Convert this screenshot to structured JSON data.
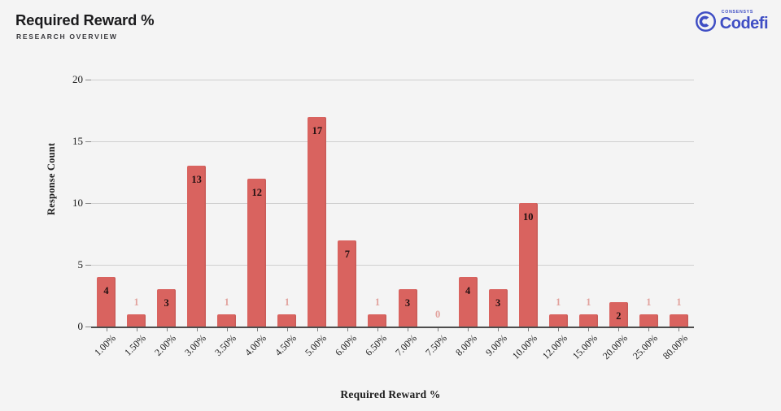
{
  "header": {
    "title": "Required Reward %",
    "subtitle": "RESEARCH OVERVIEW"
  },
  "logo": {
    "top_text": "CONSENSYS",
    "main_text": "Codefi",
    "color": "#3f4ec4"
  },
  "colors": {
    "background": "#f4f4f4",
    "bar": "#d9635f",
    "gridline": "#cfcfcf",
    "axis": "#4d4d4d",
    "label_inside": "#201011",
    "label_outside": "#e2a29d"
  },
  "chart_data": {
    "type": "bar",
    "title": "Required Reward %",
    "subtitle": "RESEARCH OVERVIEW",
    "xlabel": "Required Reward %",
    "ylabel": "Response Count",
    "ylim": [
      0,
      20
    ],
    "yticks": [
      0,
      5,
      10,
      15,
      20
    ],
    "grid": true,
    "legend": "none",
    "categories": [
      "1.00%",
      "1.50%",
      "2.00%",
      "3.00%",
      "3.50%",
      "4.00%",
      "4.50%",
      "5.00%",
      "6.00%",
      "6.50%",
      "7.00%",
      "7.50%",
      "8.00%",
      "9.00%",
      "10.00%",
      "12.00%",
      "15.00%",
      "20.00%",
      "25.00%",
      "80.00%"
    ],
    "values": [
      4,
      1,
      3,
      13,
      1,
      12,
      1,
      17,
      7,
      1,
      3,
      0,
      4,
      3,
      10,
      1,
      1,
      2,
      1,
      1
    ],
    "data_labels": [
      "4",
      "1",
      "3",
      "13",
      "1",
      "12",
      "1",
      "17",
      "7",
      "1",
      "3",
      "0",
      "4",
      "3",
      "10",
      "1",
      "1",
      "2",
      "1",
      "1"
    ]
  }
}
